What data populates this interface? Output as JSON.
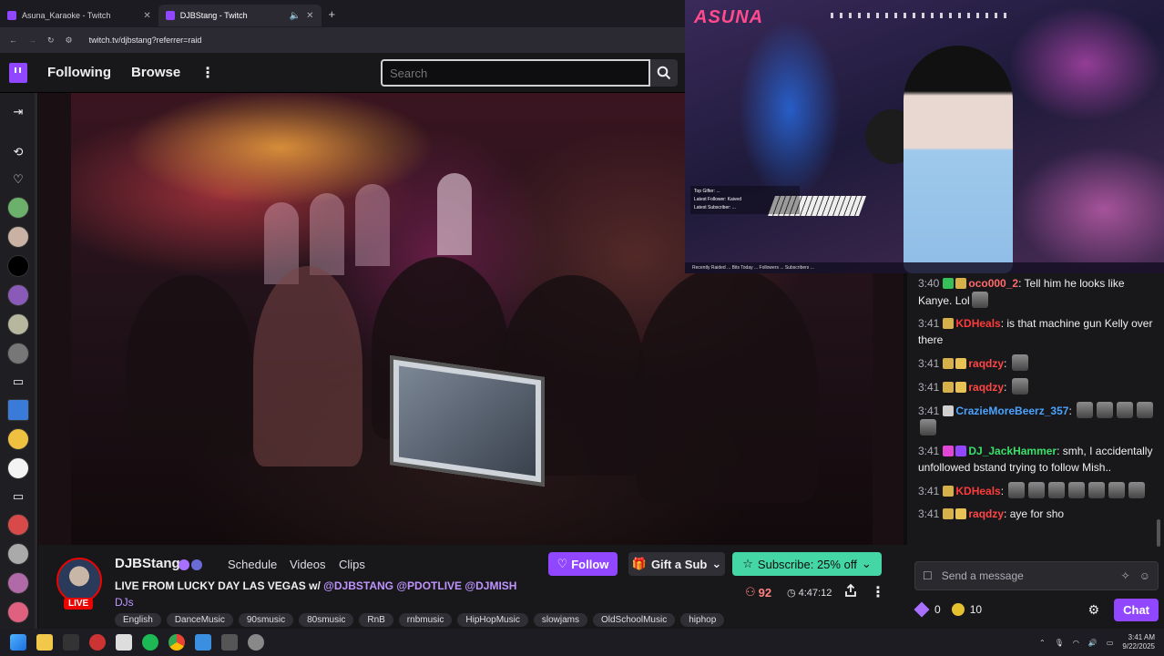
{
  "browser": {
    "tabs": [
      {
        "title": "Asuna_Karaoke - Twitch",
        "active": false
      },
      {
        "title": "DJBStang - Twitch",
        "active": true
      }
    ],
    "url": "twitch.tv/djbstang?referrer=raid"
  },
  "topnav": {
    "following": "Following",
    "browse": "Browse",
    "more": "⋮",
    "search_placeholder": "Search"
  },
  "pip": {
    "brand": "ASUNA",
    "hud_lines": [
      "Top Gifter: ...",
      "Latest Follower: Kaived",
      "Latest Subscriber: ..."
    ],
    "ticker": "Recently Raided ... Bits Today ... Followers ... Subscribers ..."
  },
  "chat": {
    "messages": [
      {
        "time": "3:40",
        "user": "oco000_2",
        "color": "#ff6a6a",
        "text": "Tell him he looks like Kanye. Lol",
        "badges": [
          "#37c05a",
          "#d6b14a"
        ],
        "emotes": 1
      },
      {
        "time": "3:41",
        "user": "KDHeals",
        "color": "#ff3a3a",
        "text": "is that machine gun Kelly over there",
        "badges": [
          "#d6b14a"
        ],
        "emotes": 0
      },
      {
        "time": "3:41",
        "user": "raqdzy",
        "color": "#ff4646",
        "text": "",
        "badges": [
          "#d6b14a",
          "#e8c252"
        ],
        "emotes": 1
      },
      {
        "time": "3:41",
        "user": "raqdzy",
        "color": "#ff4646",
        "text": "",
        "badges": [
          "#d6b14a",
          "#e8c252"
        ],
        "emotes": 1
      },
      {
        "time": "3:41",
        "user": "CrazieMoreBeerz_357",
        "color": "#4aa3ff",
        "text": "",
        "badges": [
          "#cfcfcf"
        ],
        "emotes": 5
      },
      {
        "time": "3:41",
        "user": "DJ_JackHammer",
        "color": "#39e06a",
        "text": "smh, I accidentally unfollowed bstand trying to follow Mish..",
        "badges": [
          "#e146d6",
          "#9146ff"
        ],
        "emotes": 0
      },
      {
        "time": "3:41",
        "user": "KDHeals",
        "color": "#ff3a3a",
        "text": "",
        "badges": [
          "#d6b14a"
        ],
        "emotes": 7
      },
      {
        "time": "3:41",
        "user": "raqdzy",
        "color": "#ff4646",
        "text": "aye for sho",
        "badges": [
          "#d6b14a",
          "#e8c252"
        ],
        "emotes": 0
      }
    ],
    "input_placeholder": "Send a message",
    "points": "0",
    "coins": "10",
    "chat_button": "Chat"
  },
  "channel": {
    "name": "DJBStang",
    "live": "LIVE",
    "tabs": [
      "Schedule",
      "Videos",
      "Clips"
    ],
    "title_prefix": "LIVE FROM LUCKY DAY LAS VEGAS w/",
    "mentions": [
      "@DJBSTANG",
      "@PDOTLIVE",
      "@DJMISH"
    ],
    "category": "DJs",
    "tags": [
      "English",
      "DanceMusic",
      "90smusic",
      "80smusic",
      "RnB",
      "rnbmusic",
      "HipHopMusic",
      "slowjams",
      "OldSchoolMusic",
      "hiphop"
    ],
    "follow": "Follow",
    "gift": "Gift a Sub",
    "subscribe": "Subscribe: 25% off",
    "viewers": "92",
    "uptime": "4:47:12"
  },
  "taskbar": {
    "time": "3:41 AM",
    "date": "9/22/2025"
  }
}
